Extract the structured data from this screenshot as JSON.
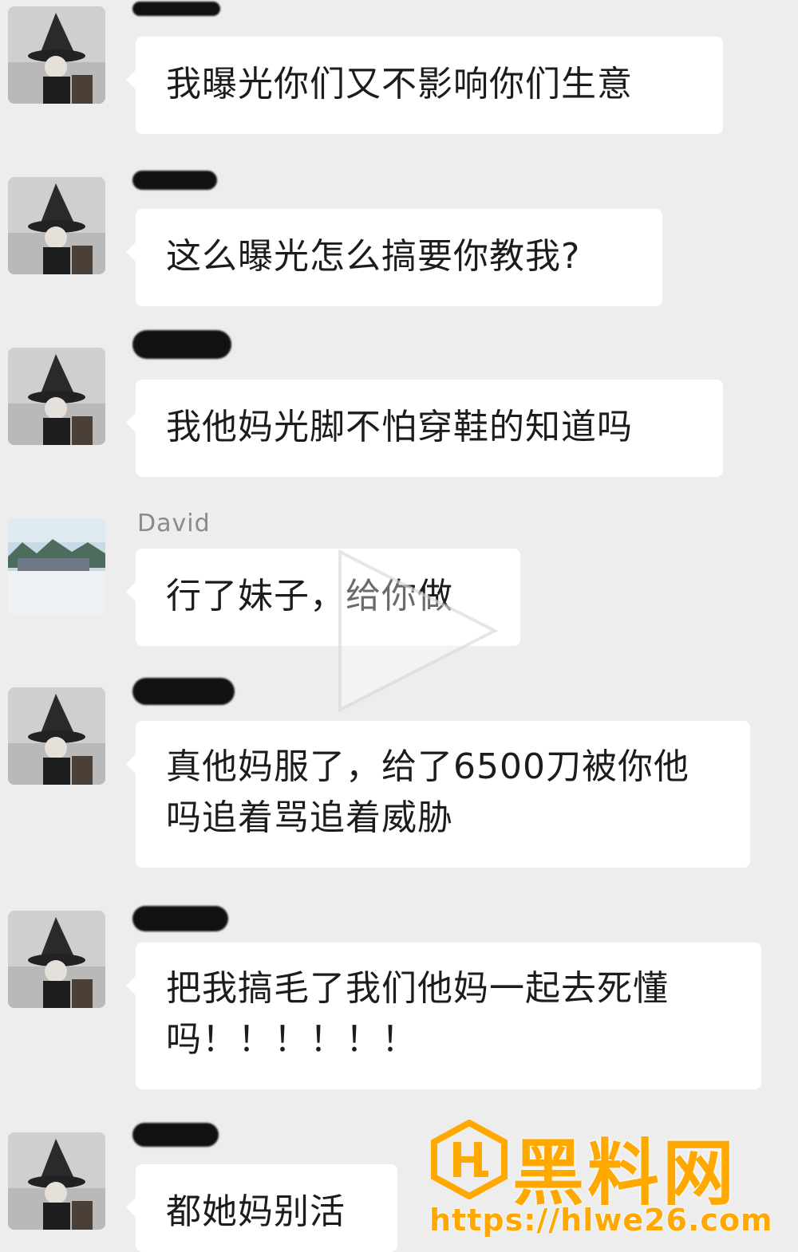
{
  "messages": [
    {
      "sender": "",
      "sender_redacted": true,
      "text": "我曝光你们又不影响你们生意"
    },
    {
      "sender": "",
      "sender_redacted": true,
      "text": "这么曝光怎么搞要你教我?"
    },
    {
      "sender": "",
      "sender_redacted": true,
      "text": "我他妈光脚不怕穿鞋的知道吗"
    },
    {
      "sender": "David",
      "sender_redacted": false,
      "text": "行了妹子，给你做"
    },
    {
      "sender": "",
      "sender_redacted": true,
      "text": "真他妈服了，给了6500刀被你他吗追着骂追着威胁"
    },
    {
      "sender": "",
      "sender_redacted": true,
      "text": "把我搞毛了我们他妈一起去死懂吗！！！！！！"
    },
    {
      "sender": "",
      "sender_redacted": true,
      "text": "都她妈别活"
    }
  ],
  "icons": {
    "avatar_default": "witch-hat-avatar-icon",
    "avatar_david": "landscape-avatar-icon",
    "video_overlay": "play-icon",
    "watermark_logo": "hl-logo-icon"
  },
  "watermark": {
    "title": "黑料网",
    "url": "https://hlwe26.com",
    "color": "#ffa800"
  },
  "colors": {
    "background": "#ededed",
    "bubble": "#ffffff",
    "text": "#1c1c1c"
  }
}
